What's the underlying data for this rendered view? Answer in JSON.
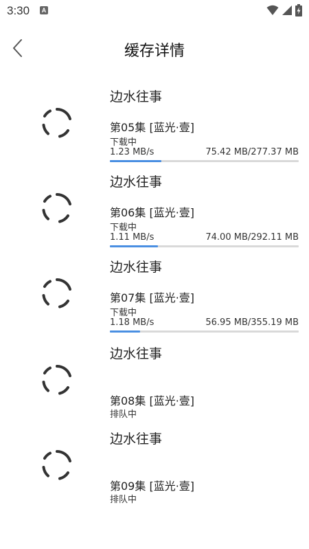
{
  "status_bar": {
    "time": "3:30",
    "notification_icon_letter": "A",
    "icons": [
      "wifi-icon",
      "signal-icon",
      "battery-charging-icon"
    ]
  },
  "header": {
    "title": "缓存详情",
    "back_icon": "chevron-left-icon"
  },
  "colors": {
    "progress_fill": "#4a8fe2",
    "progress_track": "#d9d9d9",
    "spinner": "#333333"
  },
  "tasks": [
    {
      "series": "边水往事",
      "episode": "第05集 [蓝光·壹]",
      "status": "下载中",
      "speed": "1.23 MB/s",
      "size": "75.42 MB/277.37 MB",
      "progress": 0.272
    },
    {
      "series": "边水往事",
      "episode": "第06集 [蓝光·壹]",
      "status": "下载中",
      "speed": "1.11 MB/s",
      "size": "74.00 MB/292.11 MB",
      "progress": 0.253
    },
    {
      "series": "边水往事",
      "episode": "第07集 [蓝光·壹]",
      "status": "下载中",
      "speed": "1.18 MB/s",
      "size": "56.95 MB/355.19 MB",
      "progress": 0.16
    },
    {
      "series": "边水往事",
      "episode": "第08集 [蓝光·壹]",
      "status": "排队中"
    },
    {
      "series": "边水往事",
      "episode": "第09集 [蓝光·壹]",
      "status": "排队中"
    }
  ]
}
